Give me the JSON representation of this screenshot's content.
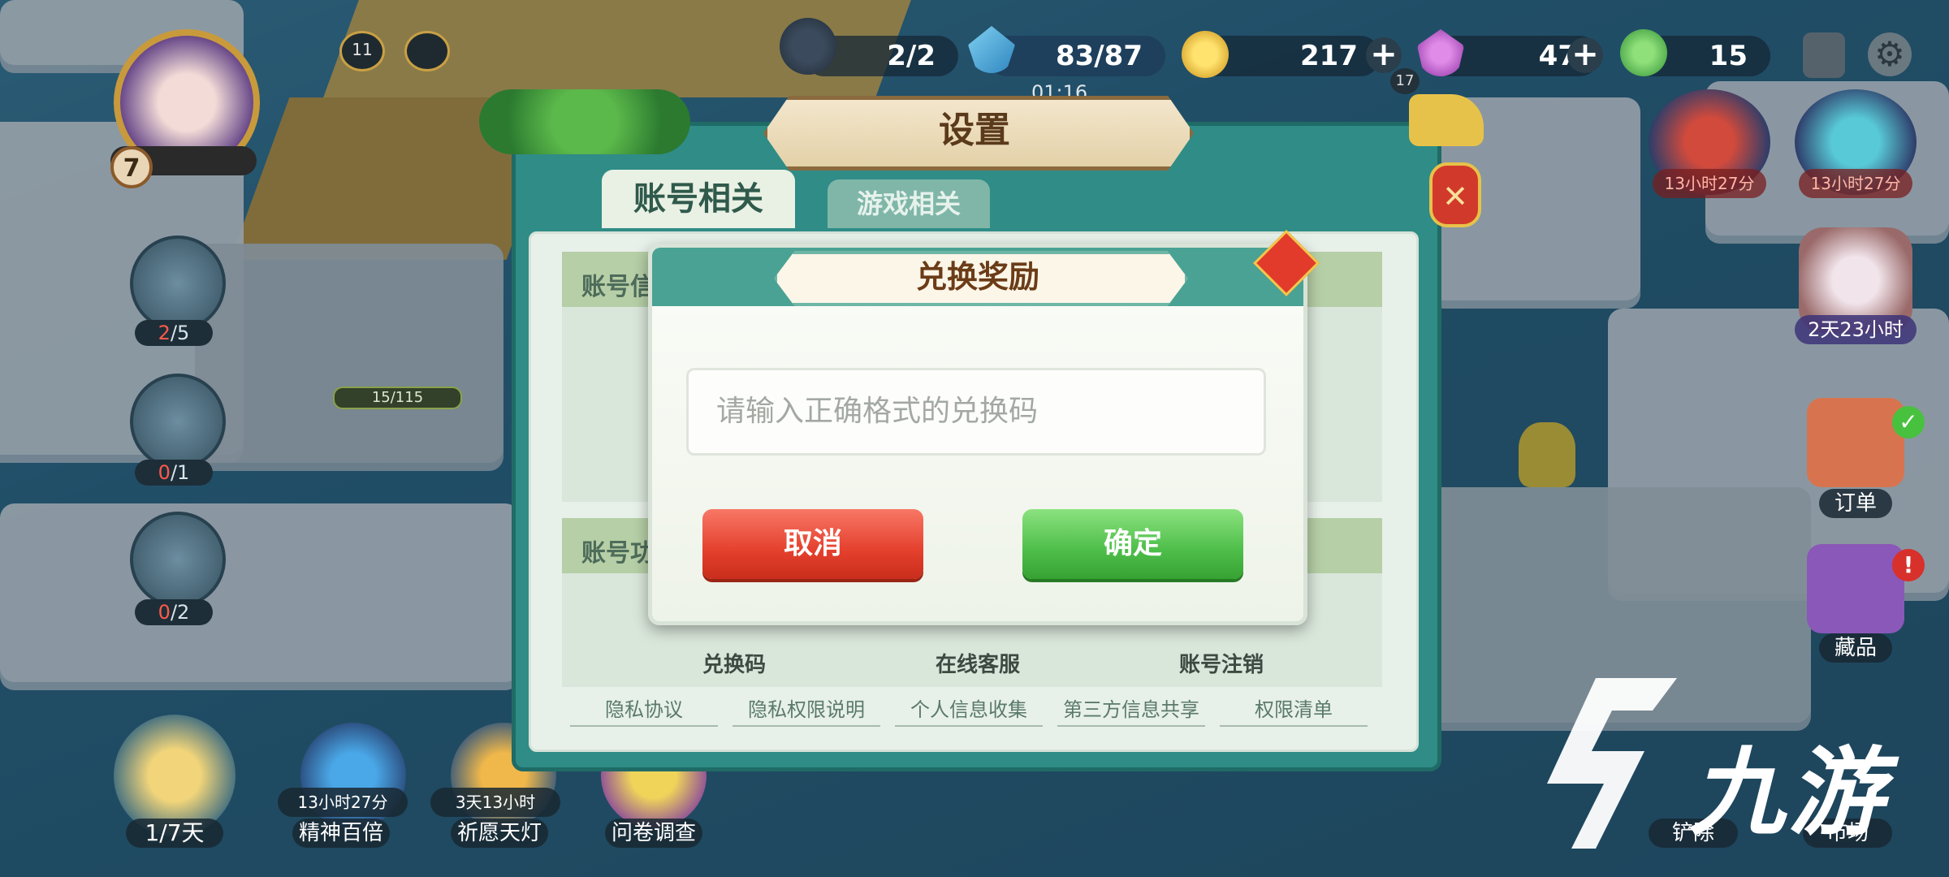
{
  "hud": {
    "player_level": "7",
    "top_left_badges": [
      "11"
    ],
    "quest_counter": "2/2",
    "energy": "83/87",
    "timer_partial": "01:16",
    "coins": "217",
    "gems": "47",
    "leaves": "15",
    "small_badge": "17"
  },
  "left_side": [
    {
      "count_red": "2",
      "count_rest": "/5"
    },
    {
      "count_red": "0",
      "count_rest": "/1"
    },
    {
      "count_red": "0",
      "count_rest": "/2"
    }
  ],
  "map_progress": "15/115",
  "right_side": {
    "timer_a": "13小时27分",
    "timer_b": "13小时27分",
    "timer_c": "2天23小时",
    "order_label": "订单",
    "collection_label": "藏品",
    "remove_label": "铲除",
    "market_label": "市场"
  },
  "bottom": {
    "days": "1/7天",
    "item1_timer": "13小时27分",
    "item1_label": "精神百倍",
    "item2_timer": "3天13小时",
    "item2_label": "祈愿天灯",
    "item3_label": "问卷调查"
  },
  "settings": {
    "title": "设置",
    "tab_account": "账号相关",
    "tab_game": "游戏相关",
    "section1_partial": "账号信",
    "section2_partial": "账号功",
    "icons": [
      "兑换码",
      "在线客服",
      "账号注销"
    ],
    "links": [
      "隐私协议",
      "隐私权限说明",
      "个人信息收集",
      "第三方信息共享",
      "权限清单"
    ]
  },
  "dialog": {
    "title": "兑换奖励",
    "input_placeholder": "请输入正确格式的兑换码",
    "cancel_label": "取消",
    "confirm_label": "确定"
  },
  "watermark": "九游",
  "colors": {
    "cancel": "#e4402d",
    "confirm": "#4dbd49",
    "panel": "#2f8c86",
    "dialog_head": "#4aa294"
  }
}
